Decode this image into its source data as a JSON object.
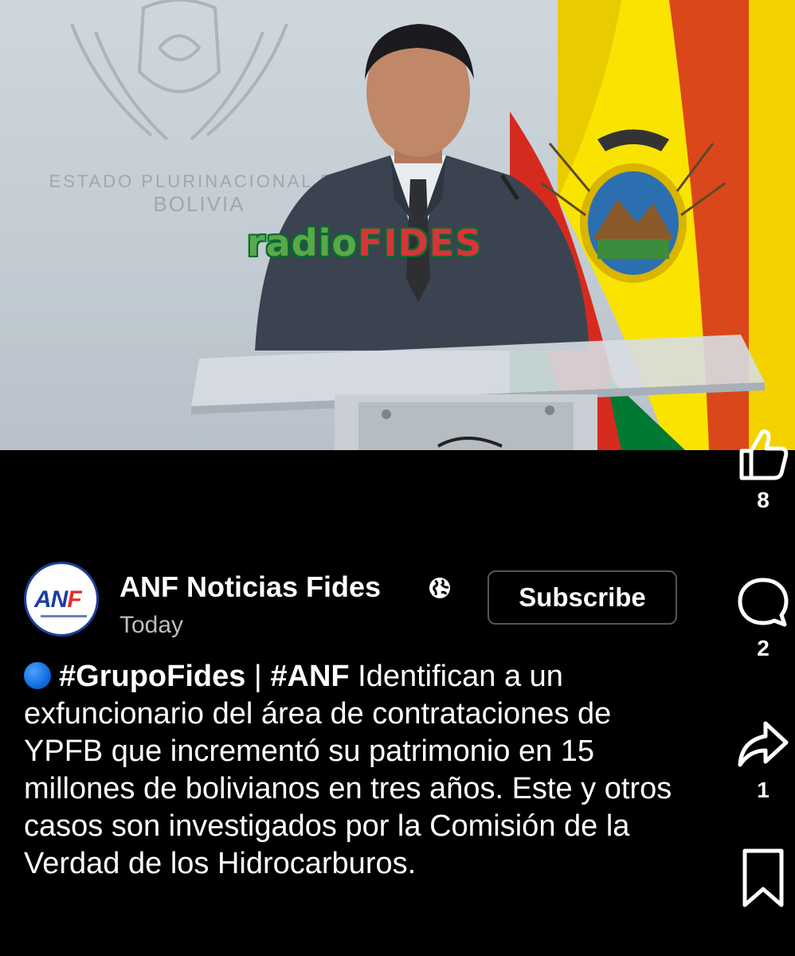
{
  "video": {
    "wall_line1": "ESTADO PLURINACIONAL DE",
    "wall_line2": "BOLIVIA",
    "watermark_a": "radio",
    "watermark_b": "FIDES"
  },
  "actions": {
    "like_count": "8",
    "comment_count": "2",
    "share_count": "1"
  },
  "channel": {
    "avatar_text_a": "AN",
    "avatar_text_b": "F",
    "name": "ANF Noticias Fides",
    "time": "Today",
    "subscribe_label": "Subscribe"
  },
  "caption": {
    "tag1": "#GrupoFides",
    "separator": " | ",
    "tag2": "#ANF",
    "text": " Identifican a un exfuncionario del área de contrataciones de YPFB que incrementó su patrimonio en 15 millones de bolivianos en tres años. Este y otros casos son investigados por la Comisión de la Verdad de los Hidrocarburos."
  },
  "colors": {
    "background": "#000000",
    "flag_red": "#d52b1e",
    "flag_yellow": "#f9e300",
    "flag_green": "#007934",
    "anf_blue": "#1c3f9c"
  },
  "icons": [
    "like-icon",
    "comment-icon",
    "share-icon",
    "save-icon",
    "globe-icon",
    "blue-circle-emoji"
  ]
}
